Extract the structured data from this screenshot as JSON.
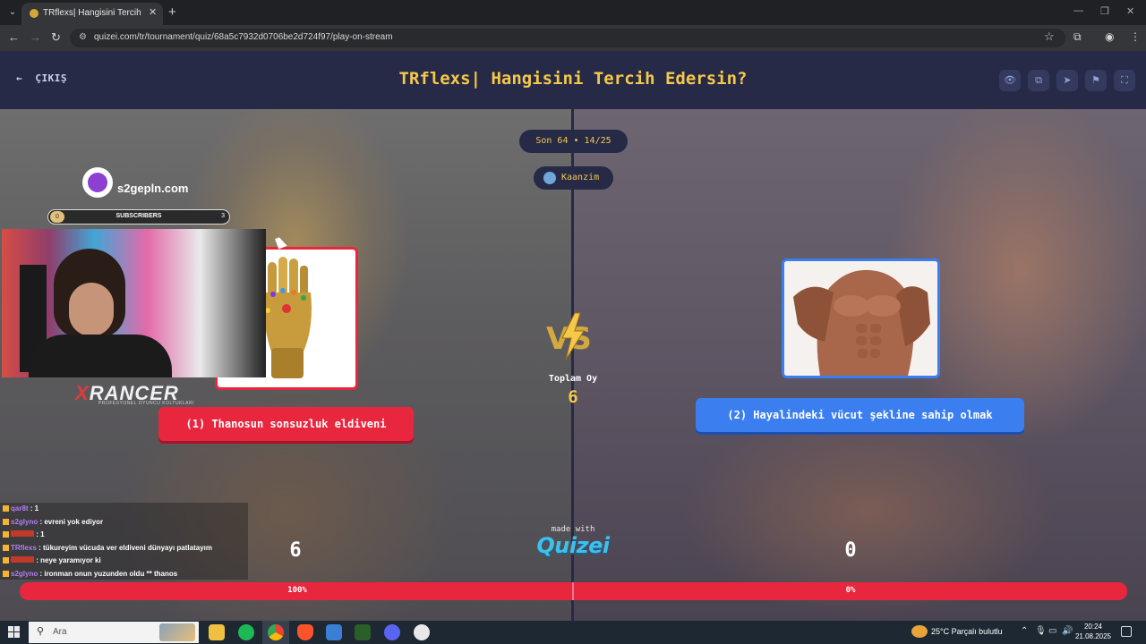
{
  "browser": {
    "tab_title": "TRflexs| Hangisini Tercih Edersin",
    "url": "quizei.com/tr/tournament/quiz/68a5c7932d0706be2d724f97/play-on-stream"
  },
  "header": {
    "exit_label": "ÇIKIŞ",
    "title": "TRflexs| Hangisini Tercih Edersin?",
    "buttons": [
      "eye-icon",
      "copy-icon",
      "send-icon",
      "flag-icon",
      "fullscreen-icon"
    ]
  },
  "match": {
    "round": "Son 64 • 14/25",
    "username": "Kaanzim",
    "total_votes_label": "Toplam Oy",
    "total_votes": "6",
    "left": {
      "label": "(1) Thanosun sonsuzluk eldiveni",
      "score": "6",
      "percent_label": "100%",
      "percent": 100,
      "color": "#e8273f"
    },
    "right": {
      "label": "(2) Hayalindeki vücut şekline sahip olmak",
      "score": "0",
      "percent_label": "0%",
      "percent": 0,
      "color": "#3b7ef0"
    },
    "made_with": "made with",
    "brand": "Quizei"
  },
  "overlay": {
    "site": "s2gepln.com",
    "subscribers_label": "SUBSCRIBERS",
    "sub_min": "0",
    "sub_max": "3",
    "sponsor": "RANCER",
    "sponsor_x": "X",
    "sponsor_sub": "PROFESYONEL OYUNCU KOLTUKLARI",
    "chat": [
      {
        "user": "qar8t",
        "msg": ": 1"
      },
      {
        "user": "s2glyno",
        "msg": ": evreni yok ediyor"
      },
      {
        "user": "",
        "msg": ": 1"
      },
      {
        "user": "TRflexs",
        "msg": ": tükureyim vücuda ver eldiveni dünyayı patlatayım"
      },
      {
        "user": "",
        "msg": ": neye yaramıyor ki"
      },
      {
        "user": "s2glyno",
        "msg": ": ironman onun yuzunden oldu ** thanos"
      }
    ]
  },
  "taskbar": {
    "search_placeholder": "Ara",
    "weather": "25°C  Parçalı bulutlu",
    "time": "20:24",
    "date": "21.08.2025"
  }
}
